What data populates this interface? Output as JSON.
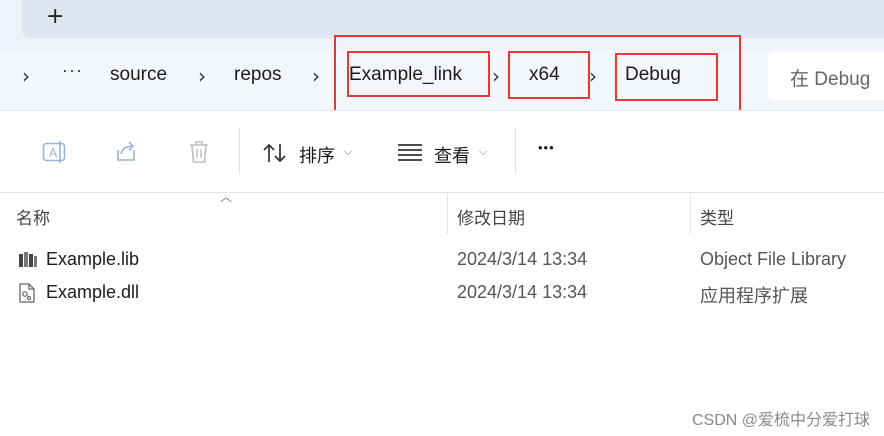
{
  "tabbar": {
    "new_tab_icon": "plus-icon",
    "new_tab_label": "+"
  },
  "breadcrumb": {
    "overflow_label": "···",
    "items": [
      "source",
      "repos",
      "Example_link",
      "x64",
      "Debug"
    ],
    "separator_icon": "chevron-right-icon"
  },
  "search": {
    "placeholder": "在 Debug 中搜索",
    "visible_text": "在 Debug"
  },
  "toolbar": {
    "rename_icon": "rename-icon",
    "share_icon": "share-icon",
    "delete_icon": "trash-icon",
    "sort_label": "排序",
    "view_label": "查看",
    "more_label": "•••"
  },
  "columns": {
    "name": "名称",
    "date": "修改日期",
    "type": "类型"
  },
  "files": [
    {
      "name": "Example.lib",
      "date": "2024/3/14 13:34",
      "type": "Object File Library",
      "icon": "library-file-icon"
    },
    {
      "name": "Example.dll",
      "date": "2024/3/14 13:34",
      "type": "应用程序扩展",
      "icon": "dll-file-icon"
    }
  ],
  "annotation_color": "#e53935",
  "watermark": "CSDN @爱梳中分爱打球"
}
